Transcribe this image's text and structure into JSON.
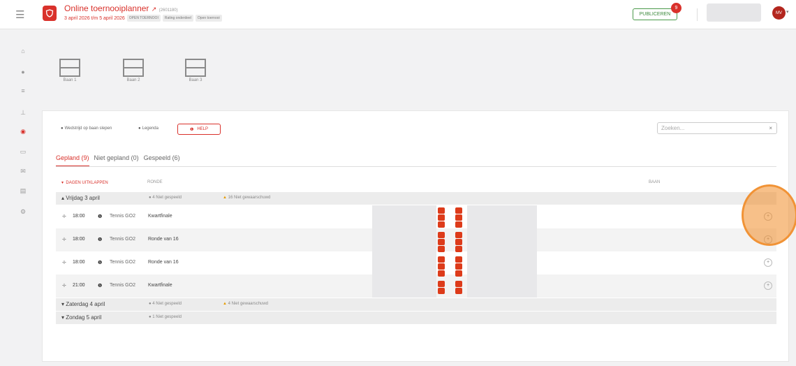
{
  "header": {
    "title": "Online toernooiplanner",
    "title_id": "(2601180)",
    "dates": "3 april 2026 t/m 5 april 2026",
    "tags": [
      "OPEN TOERNOOI",
      "Rating onderdeel",
      "Open toernooi"
    ],
    "publish_label": "PUBLICEREN",
    "publish_count": "9",
    "avatar_initials": "MV"
  },
  "courts": [
    {
      "label": "Baan 1"
    },
    {
      "label": "Baan 2"
    },
    {
      "label": "Baan 3"
    }
  ],
  "toolbar": {
    "chip1": "Wedstrijd op baan slepen",
    "chip2": "Legenda",
    "help_label": "HELP",
    "search_placeholder": "Zoeken...",
    "search_clear": "×"
  },
  "tabs": [
    {
      "label": "Gepland (9)",
      "active": true
    },
    {
      "label": "Niet gepland (0)",
      "active": false
    },
    {
      "label": "Gespeeld (6)",
      "active": false
    }
  ],
  "table": {
    "col_days": "DAGEN UITKLAPPEN",
    "col_round": "RONDE",
    "col_court": "BAAN"
  },
  "days": [
    {
      "label": "Vrijdag 3 april",
      "caret": "▴",
      "not_played": "4 Niet gespeeld",
      "not_notified": "16 Niet gewaarschuwd"
    },
    {
      "label": "Zaterdag 4 april",
      "caret": "▾",
      "not_played": "4 Niet gespeeld",
      "not_notified": "4 Niet gewaarschuwd"
    },
    {
      "label": "Zondag 5 april",
      "caret": "▾",
      "not_played": "1 Niet gespeeld",
      "not_notified": ""
    }
  ],
  "matches": [
    {
      "time": "18:00",
      "location": "Tennis GO2",
      "round": "Kwartfinale"
    },
    {
      "time": "18:00",
      "location": "Tennis GO2",
      "round": "Ronde van 16"
    },
    {
      "time": "18:00",
      "location": "Tennis GO2",
      "round": "Ronde van 16"
    },
    {
      "time": "21:00",
      "location": "Tennis GO2",
      "round": "Kwartfinale"
    }
  ],
  "colors": {
    "brand": "#d9312b",
    "publish": "#3d8a3d",
    "warning": "#e69b00",
    "cursor_highlight": "#f08c28"
  }
}
